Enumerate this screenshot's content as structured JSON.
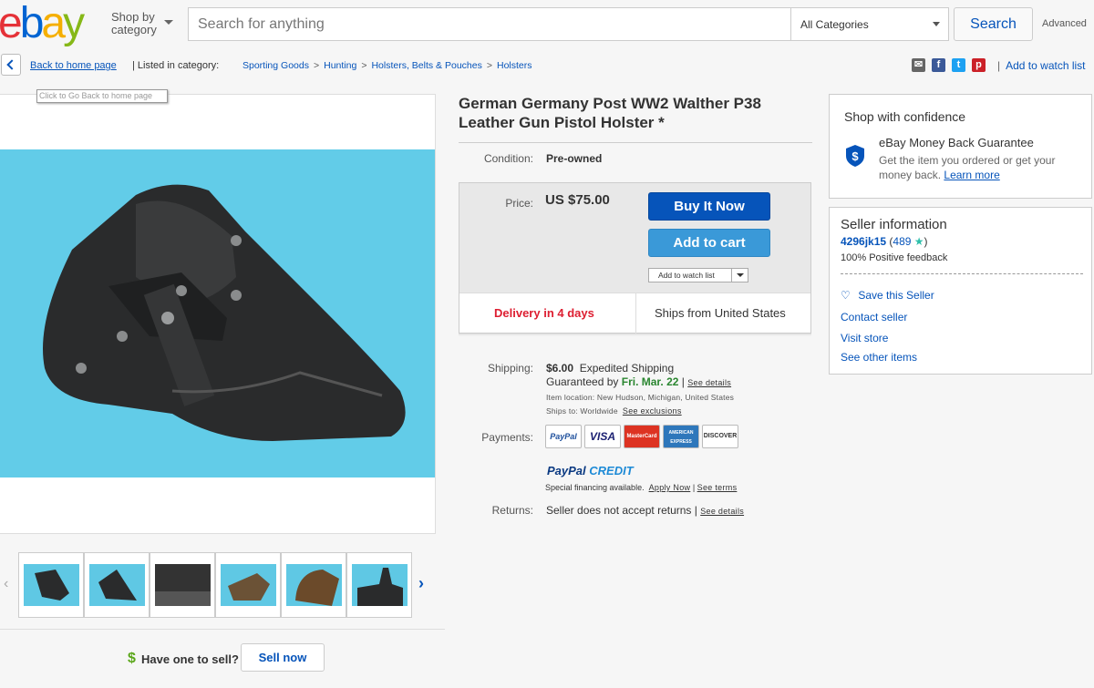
{
  "header": {
    "logo_text": "ebay",
    "shop_by": "Shop by",
    "category": "category",
    "search_placeholder": "Search for anything",
    "category_select": "All Categories",
    "search_button": "Search",
    "advanced": "Advanced"
  },
  "nav": {
    "back_to_home": "Back to home page",
    "listed_in": "| Listed in category:",
    "breadcrumbs": [
      "Sporting Goods",
      "Hunting",
      "Holsters, Belts & Pouches",
      "Holsters"
    ],
    "tooltip": "Click to Go Back to home page",
    "add_to_watch_list": "Add to watch list"
  },
  "gallery": {
    "thumbnails": [
      "thumb-1",
      "thumb-2",
      "thumb-3",
      "thumb-4",
      "thumb-5",
      "thumb-6"
    ],
    "sell_prompt": "Have one to sell?",
    "sell_button": "Sell now"
  },
  "item": {
    "title": "German Germany Post WW2 Walther P38 Leather Gun Pistol Holster *",
    "condition_label": "Condition:",
    "condition_value": "Pre-owned",
    "price_label": "Price:",
    "price_value": "US $75.00",
    "buy_now": "Buy It Now",
    "add_to_cart": "Add to cart",
    "add_to_watch_list": "Add to watch list",
    "delivery": "Delivery in 4 days",
    "ships_from": "Ships from United States",
    "shipping_label": "Shipping:",
    "shipping_cost": "$6.00",
    "shipping_method": "Expedited Shipping",
    "guaranteed_by": "Guaranteed by",
    "guaranteed_date": "Fri. Mar. 22",
    "see_details": "See details",
    "item_location": "Item location:  New Hudson, Michigan, United States",
    "ships_to": "Ships to:  Worldwide",
    "see_exclusions": "See exclusions",
    "payments_label": "Payments:",
    "payment_methods": [
      "PayPal",
      "VISA",
      "MasterCard",
      "AMERICAN EXPRESS",
      "DISCOVER"
    ],
    "paypal_credit_a": "PayPal",
    "paypal_credit_b": "CREDIT",
    "financing": "Special financing available.",
    "apply_now": "Apply Now",
    "see_terms": "See terms",
    "returns_label": "Returns:",
    "returns_value": "Seller does not accept returns",
    "returns_details": "See details"
  },
  "confidence": {
    "title": "Shop with confidence",
    "mbg_title": "eBay Money Back Guarantee",
    "mbg_text": "Get the item you ordered or get your money back.",
    "learn_more": "Learn more"
  },
  "seller": {
    "title": "Seller information",
    "name": "4296jk15",
    "score": "489",
    "feedback": "100% Positive feedback",
    "save_seller": "Save this Seller",
    "contact": "Contact seller",
    "visit_store": "Visit store",
    "other_items": "See other items"
  },
  "colors": {
    "link": "#0654ba",
    "buy_now": "#0654ba",
    "add_to_cart": "#3a99d8",
    "delivery": "#dd1e31",
    "guarantee_date": "#2a8630",
    "image_bg": "#62cce8"
  }
}
